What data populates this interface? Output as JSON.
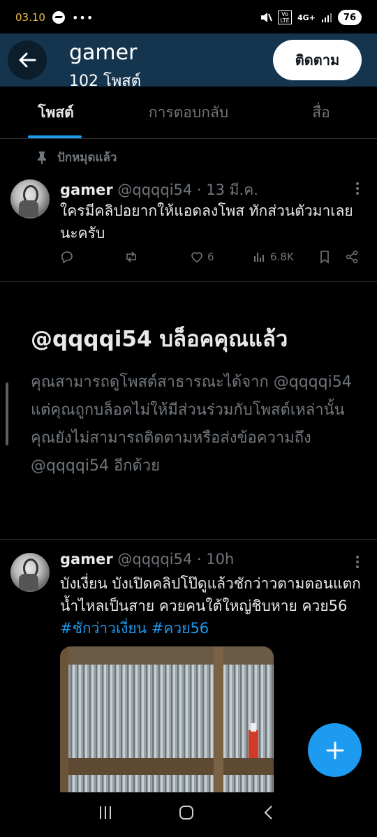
{
  "status_bar": {
    "time": "03.10",
    "network": "4G+",
    "volte": "Vo LTE",
    "battery": "76"
  },
  "header": {
    "title": "gamer",
    "subtitle": "102 โพสต์",
    "follow_label": "ติดตาม"
  },
  "tabs": [
    {
      "label": "โพสต์",
      "active": true
    },
    {
      "label": "การตอบกลับ",
      "active": false
    },
    {
      "label": "สื่อ",
      "active": false
    }
  ],
  "pinned_label": "ปักหมุดแล้ว",
  "pinned_tweet": {
    "name": "gamer",
    "meta": "@qqqqi54 · 13 มี.ค.",
    "text": "ใครมีคลิปอยากให้แอดลงโพส ทักส่วนตัวมาเลยนะครับ",
    "likes": "6",
    "views": "6.8K"
  },
  "blocked": {
    "title": "@qqqqi54 บล็อคคุณแล้ว",
    "text": "คุณสามารถดูโพสต์สาธารณะได้จาก @qqqqi54 แต่คุณถูกบล็อคไม่ให้มีส่วนร่วมกับโพสต์เหล่านั้น คุณยังไม่สามารถติดตามหรือส่งข้อความถึง @qqqqi54 อีกด้วย"
  },
  "tweet2": {
    "name": "gamer",
    "meta": "@qqqqi54 · 10h",
    "text": "บังเงี่ยน บังเปิดคลิปโป๊ดูแล้วชักว่าวตามตอนแตกน้ำไหลเป็นสาย ควยคนใต้ใหญ่ชิบหาย ควย56",
    "hashtags": "#ชักว่าวเงี่ยน #ควย56"
  },
  "colors": {
    "accent": "#1d9bf0",
    "header_bg": "#15354f",
    "muted": "#71767b"
  }
}
